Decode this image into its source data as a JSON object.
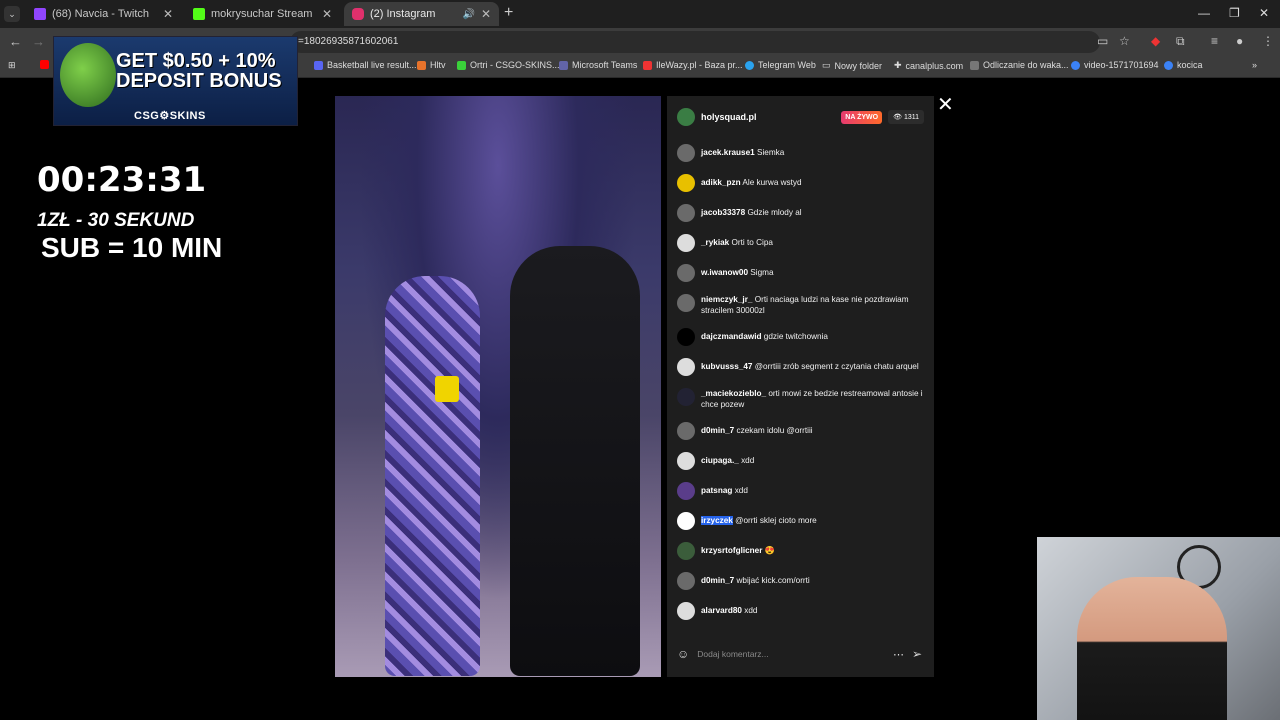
{
  "tabs": [
    {
      "title": "(68) Navcia - Twitch",
      "color": "#9146ff"
    },
    {
      "title": "mokrysuchar Stream - Watch Li",
      "color": "#53fc18"
    },
    {
      "title": "(2) Instagram",
      "color": "#e1306c"
    }
  ],
  "toolbar": {
    "url": "=18026935871602061"
  },
  "bookmarks": [
    "Basketball live result...",
    "Hltv",
    "Ortri - CSGO-SKINS...",
    "Microsoft Teams",
    "IleWazy.pl - Baza pr...",
    "Telegram Web",
    "Nowy folder",
    "canalplus.com",
    "Odliczanie do waka...",
    "video-1571701694",
    "kocica"
  ],
  "promo": {
    "headline": "GET $0.50 + 10% DEPOSIT BONUS",
    "brand": "CSG⚙SKINS"
  },
  "overlay": {
    "timer": "00:23:31",
    "rate": "1ZŁ - 30 SEKUND",
    "sub": "SUB = 10 MIN"
  },
  "live": {
    "account": "holysquad.pl",
    "badge": "NA ŻYWO",
    "viewers": "1311",
    "comment_placeholder": "Dodaj komentarz..."
  },
  "comments": [
    {
      "user": "jacek.krause1",
      "text": "Siemka"
    },
    {
      "user": "adikk_pzn",
      "text": "Ale kurwa wstyd"
    },
    {
      "user": "jacob33378",
      "text": "Gdzie mlody al"
    },
    {
      "user": "_rykiak",
      "text": "Orti to Cipa"
    },
    {
      "user": "w.iwanow00",
      "text": "Sigma"
    },
    {
      "user": "niemczyk_jr_",
      "text": "Orti naciaga ludzi na kase nie pozdrawiam stracilem 30000zl"
    },
    {
      "user": "dajczmandawid",
      "text": "gdzie twitchownia"
    },
    {
      "user": "kubvusss_47",
      "text": "@orrtiii zrób segment z czytania chatu arquel"
    },
    {
      "user": "_maciekozieblo_",
      "text": "orti mowi ze bedzie restreamowal antosie i chce pozew"
    },
    {
      "user": "d0min_7",
      "text": "czekam idolu @orrtiii"
    },
    {
      "user": "ciupaga._",
      "text": "xdd"
    },
    {
      "user": "patsnag",
      "text": "xdd"
    },
    {
      "user": "irzyczek",
      "text": "@orrti sklej cioto more"
    },
    {
      "user": "krzysrtofglicner",
      "text": "😍"
    },
    {
      "user": "d0min_7",
      "text": "wbijać kick.com/orrti"
    },
    {
      "user": "alarvard80",
      "text": "xdd"
    }
  ]
}
